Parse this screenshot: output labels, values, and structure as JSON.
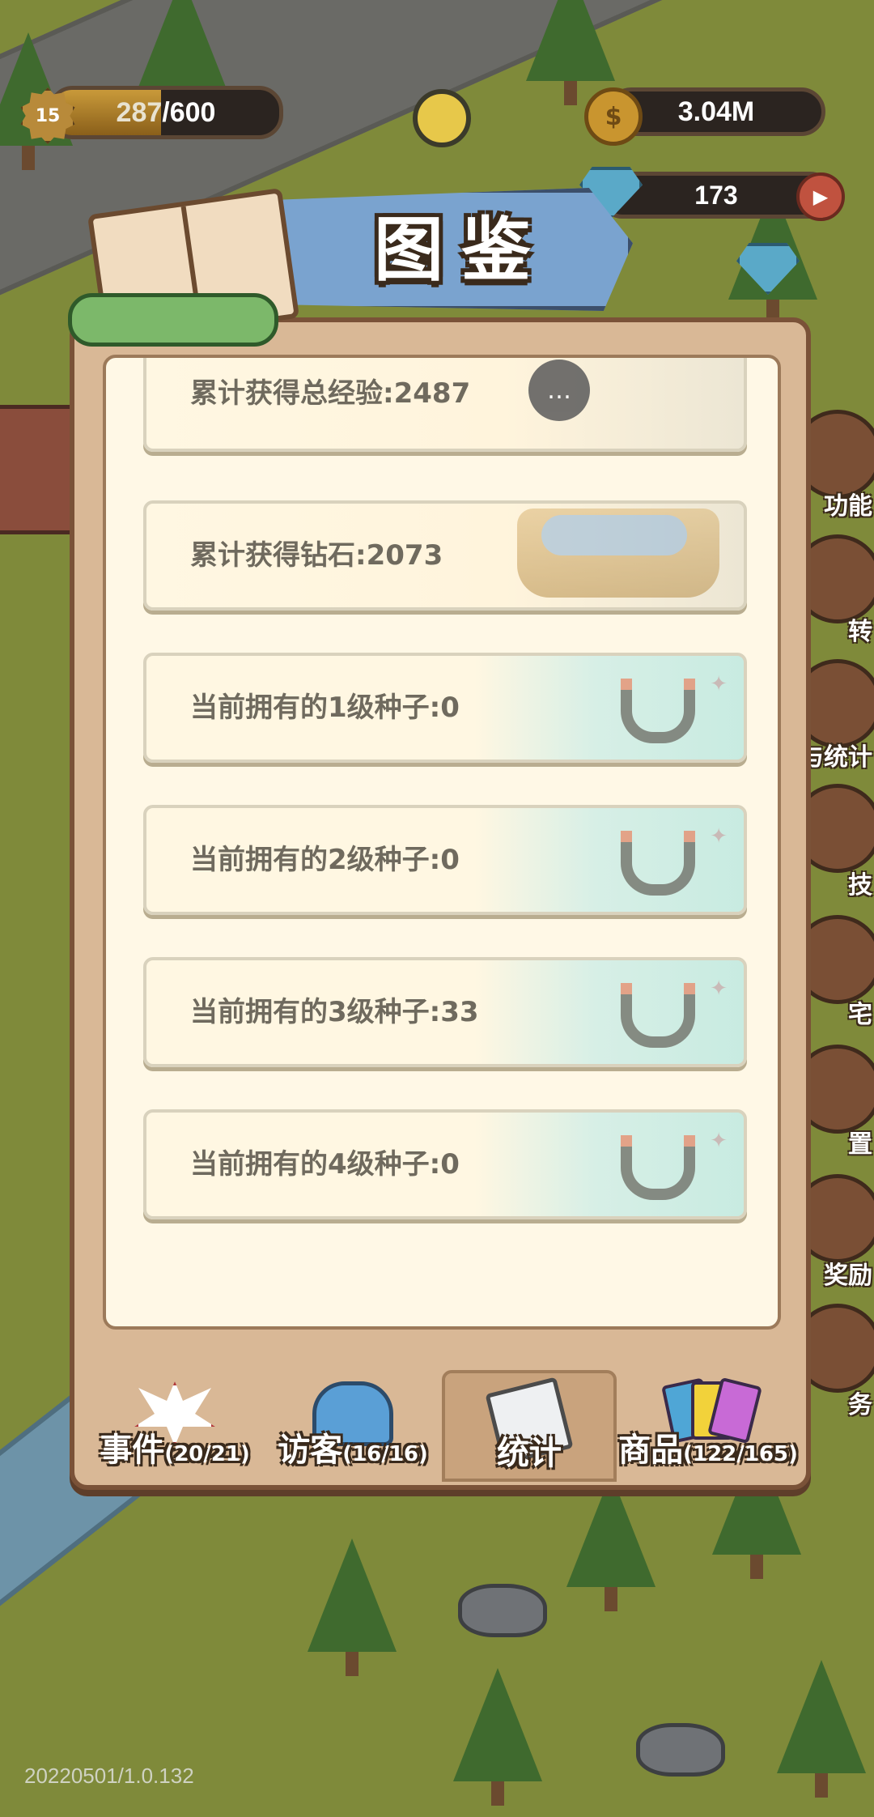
{
  "hud": {
    "level": "15",
    "xp_current": "287",
    "xp_separator": "/600",
    "xp_fraction": 0.478,
    "coins": "3.04M",
    "gems": "173",
    "icons": [
      "level-star-icon",
      "coin-icon",
      "diamond-icon",
      "play-icon",
      "sun-icon"
    ]
  },
  "panel": {
    "title": "图鉴",
    "stats": [
      {
        "label": "累计获得总经验:2487"
      },
      {
        "label": "累计获得钻石:2073"
      },
      {
        "label": "当前拥有的1级种子:0"
      },
      {
        "label": "当前拥有的2级种子:0"
      },
      {
        "label": "当前拥有的3级种子:33"
      },
      {
        "label": "当前拥有的4级种子:0"
      }
    ]
  },
  "tabs": [
    {
      "label": "事件",
      "count": "(20/21)",
      "active": false,
      "icon": "event-icon"
    },
    {
      "label": "访客",
      "count": "(16/16)",
      "active": false,
      "icon": "visitor-icon"
    },
    {
      "label": "统计",
      "count": "",
      "active": true,
      "icon": "clipboard-icon"
    },
    {
      "label": "商品",
      "count": "(122/165)",
      "active": false,
      "icon": "cards-icon"
    }
  ],
  "side_menu": [
    "功能",
    "转",
    "与统计",
    "技",
    "宅",
    "置",
    "奖励",
    "务"
  ],
  "version": "20220501/1.0.132",
  "colors": {
    "panel": "#d9b896",
    "panel_inner": "#fff8e6",
    "banner": "#7aa3cf",
    "stat_text": "#6f6a5e"
  }
}
